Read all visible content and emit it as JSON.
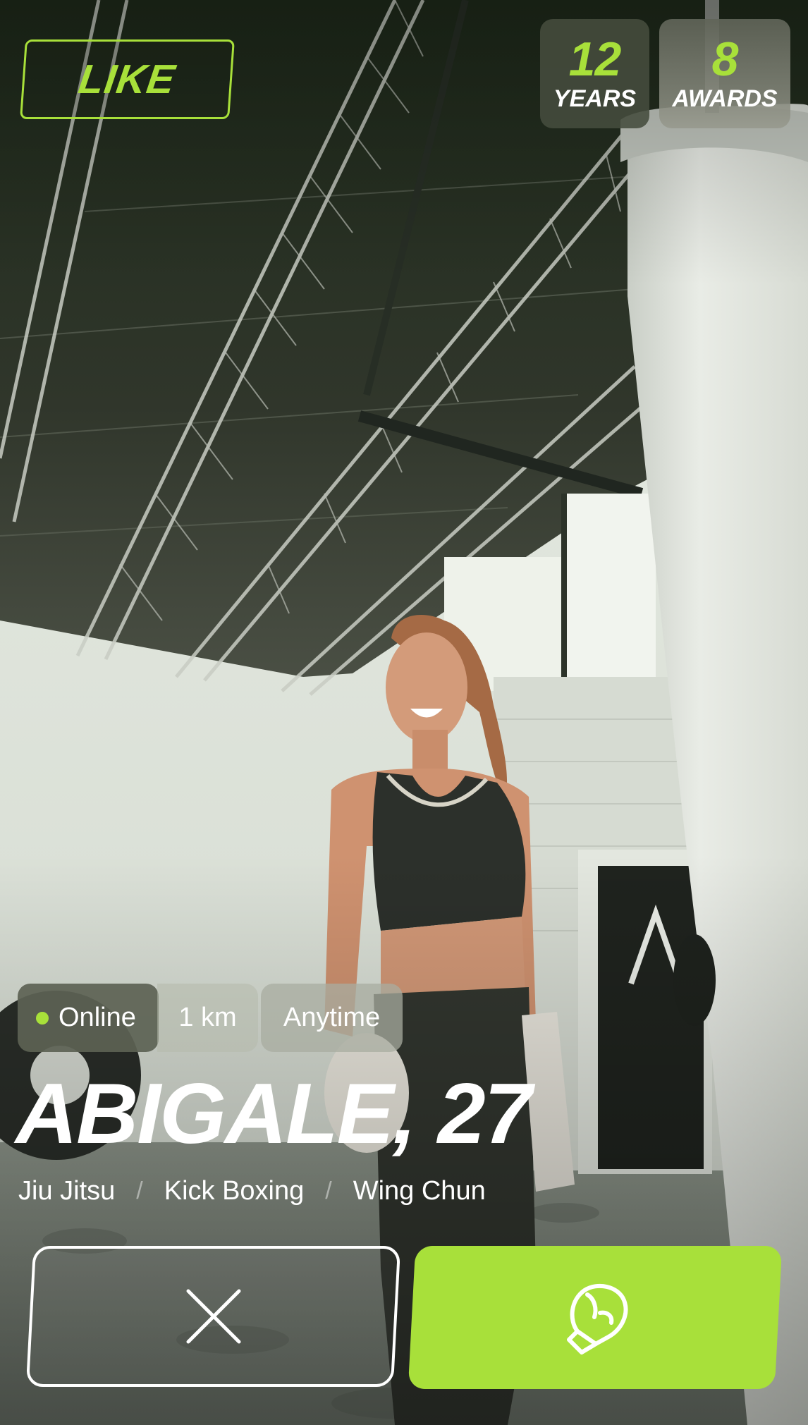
{
  "like_badge": {
    "label": "LIKE"
  },
  "stats": [
    {
      "value": "12",
      "label": "YEARS"
    },
    {
      "value": "8",
      "label": "AWARDS"
    }
  ],
  "chips": {
    "status": "Online",
    "distance": "1 km",
    "availability": "Anytime"
  },
  "profile": {
    "name_age": "ABIGALE, 27",
    "disciplines": [
      "Jiu Jitsu",
      "Kick Boxing",
      "Wing Chun"
    ],
    "separator": "/"
  },
  "actions": {
    "dismiss_icon": "close-icon",
    "like_icon": "boxing-glove-icon"
  },
  "colors": {
    "accent": "#a8e03a",
    "text": "#ffffff"
  }
}
